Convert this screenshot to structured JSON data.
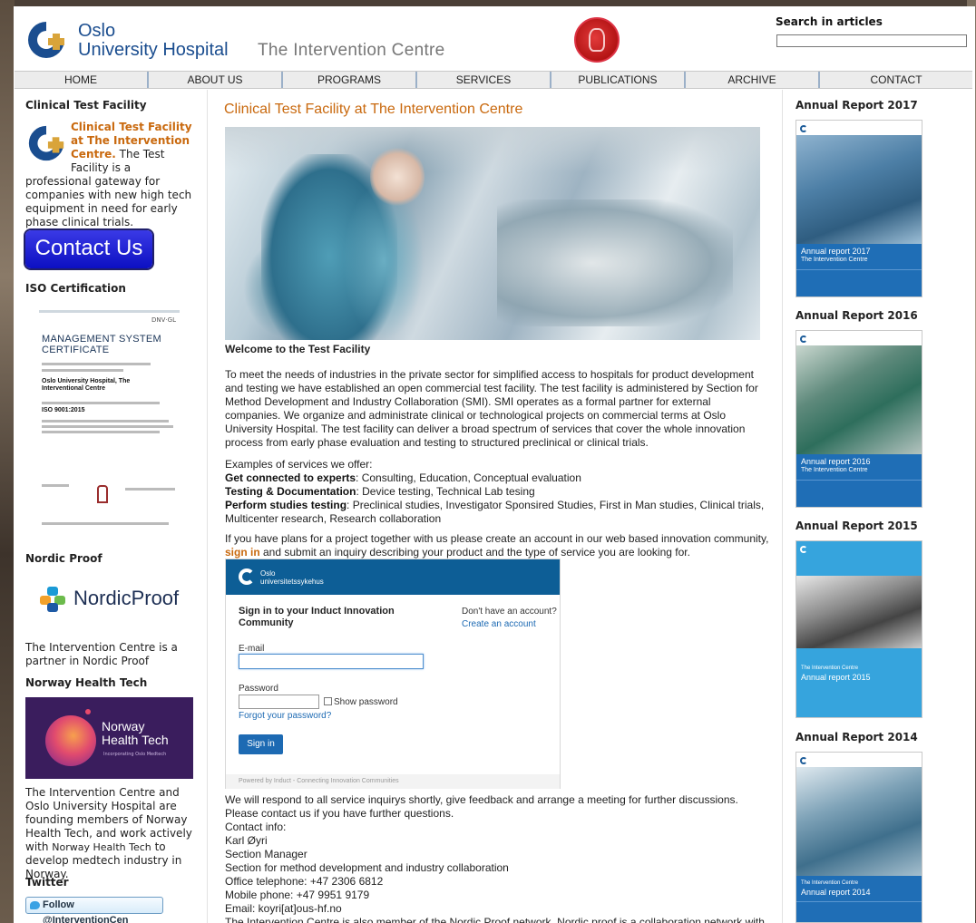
{
  "header": {
    "logo_line1": "Oslo",
    "logo_line2": "University Hospital",
    "subtitle": "The Intervention Centre",
    "search_label": "Search in articles"
  },
  "nav": [
    "HOME",
    "ABOUT US",
    "PROGRAMS",
    "SERVICES",
    "PUBLICATIONS",
    "ARCHIVE",
    "CONTACT"
  ],
  "left": {
    "ctf_heading": "Clinical Test Facility",
    "ctf_link": "Clinical Test Facility at The Intervention Centre.",
    "ctf_text": "The Test Facility is a professional gateway for companies with new high tech equipment in need for early phase clinical trials.",
    "contact_button": "Contact Us",
    "iso_heading": "ISO Certification",
    "iso_cert": {
      "brand": "DNV·GL",
      "title": "MANAGEMENT SYSTEM CERTIFICATE",
      "org": "Oslo University Hospital, The Interventional Centre",
      "standard": "ISO 9001:2015"
    },
    "nordic_heading": "Nordic Proof",
    "nordic_logo": "NordicProof",
    "nordic_text": "The Intervention Centre is a partner in Nordic Proof",
    "nht_heading": "Norway Health Tech",
    "nht_logo_line1": "Norway",
    "nht_logo_line2": "Health Tech",
    "nht_logo_sub": "Incorporating Oslo Medtech",
    "nht_text_a": "The Intervention Centre and Oslo University Hospital are founding members of Norway Health Tech, and work actively with ",
    "nht_text_link": "Norway Health Tech",
    "nht_text_b": " to develop medtech industry in Norway.",
    "twitter_heading": "Twitter",
    "twitter_button": "Follow @InterventionCen"
  },
  "main": {
    "title": "Clinical Test Facility at The Intervention Centre",
    "welcome": "Welcome to the Test Facility",
    "intro": "To meet the needs of industries in the private sector for simplified access to hospitals for product development and testing we have established an open commercial test facility. The test facility is administered by Section for Method Development and Industry Collaboration (SMI). SMI operates as a formal partner for external companies. We organize and administrate clinical or technological projects on commercial terms at Oslo University Hospital. The test facility can deliver a broad spectrum of services that cover the whole innovation process from early phase evaluation and testing to structured preclinical or clinical trials.",
    "examples_intro": "Examples of services we offer:",
    "services": [
      {
        "label": "Get connected to experts",
        "text": ": Consulting, Education, Conceptual evaluation"
      },
      {
        "label": "Testing & Documentation",
        "text": ": Device testing, Technical Lab tesing"
      },
      {
        "label": "Perform studies testing",
        "text": ": Preclinical studies, Investigator Sponsired Studies, First in Man studies, Clinical trials, Multicenter research, Research collaboration"
      }
    ],
    "plans_a": "If you have plans for a project together with us please create an account in our web based innovation community, ",
    "plans_link": "sign in",
    "plans_b": " and submit an inquiry describing your product and the type of service you are looking for.",
    "signin": {
      "brand_line1": "Oslo",
      "brand_line2": "universitetssykehus",
      "title": "Sign in to your Induct Innovation Community",
      "no_account": "Don't have an account?",
      "create_account": "Create an account",
      "email_label": "E-mail",
      "password_label": "Password",
      "show_password": "Show password",
      "forgot": "Forgot your password?",
      "button": "Sign in",
      "footer": "Powered by Induct - Connecting Innovation Communities"
    },
    "respond": "We will respond to all service inquirys shortly, give feedback and arrange a meeting for further discussions. Please contact us if you have further questions.",
    "contact_lines": [
      "Contact info:",
      "Karl Øyri",
      "Section Manager",
      "Section for method development and industry collaboration",
      "Office telephone: +47 2306 6812",
      "Mobile phone: +47 9951 9179",
      "Email: koyri[at]ous-hf.no",
      "The Intervention Centre is also member of the Nordic Proof network. Nordic proof is a collaboration network with"
    ]
  },
  "right": {
    "reports": [
      {
        "heading": "Annual Report 2017",
        "cover_title": "Annual report 2017",
        "cover_sub": "The Intervention Centre"
      },
      {
        "heading": "Annual Report 2016",
        "cover_title": "Annual report 2016",
        "cover_sub": "The Intervention Centre"
      },
      {
        "heading": "Annual Report 2015",
        "cover_title": "Annual report 2015",
        "cover_sub": "The Intervention Centre"
      },
      {
        "heading": "Annual Report 2014",
        "cover_title": "Annual report 2014",
        "cover_sub": "The Intervention Centre"
      }
    ]
  },
  "colors": {
    "accent_orange": "#c9690e",
    "brand_blue": "#1a4d8f",
    "report_blue": "#1f6eb6"
  }
}
